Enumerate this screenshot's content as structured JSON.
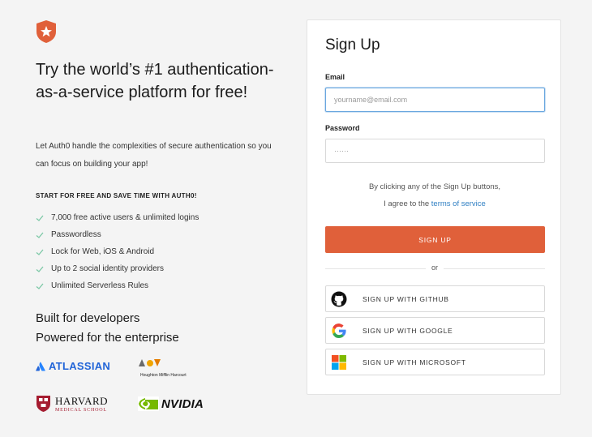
{
  "left": {
    "headline": "Try the world’s #1 authentication-as-a-service platform for free!",
    "intro": "Let Auth0 handle the complexities of secure authentication so you can focus on building your app!",
    "start_label": "START FOR FREE AND SAVE TIME WITH AUTH0!",
    "features": [
      "7,000 free active users & unlimited logins",
      "Passwordless",
      "Lock for Web, iOS & Android",
      "Up to 2 social identity providers",
      "Unlimited Serverless Rules"
    ],
    "built_line1": "Built for developers",
    "built_line2": "Powered for the enterprise",
    "logos": {
      "atlassian": "ATLASSIAN",
      "hmh": "Houghton Mifflin Harcourt",
      "harvard_main": "HARVARD",
      "harvard_sub": "MEDICAL SCHOOL",
      "nvidia": "NVIDIA"
    }
  },
  "card": {
    "title": "Sign Up",
    "email_label": "Email",
    "email_placeholder": "yourname@email.com",
    "email_value": "",
    "password_label": "Password",
    "password_placeholder": "······",
    "terms_line1": "By clicking any of the Sign Up buttons,",
    "terms_prefix": "I agree to the ",
    "terms_link": "terms of service",
    "signup_label": "SIGN UP",
    "or_label": "or",
    "social": [
      {
        "label": "SIGN UP WITH GITHUB",
        "icon": "github-icon"
      },
      {
        "label": "SIGN UP WITH GOOGLE",
        "icon": "google-icon"
      },
      {
        "label": "SIGN UP WITH MICROSOFT",
        "icon": "microsoft-icon"
      }
    ]
  },
  "colors": {
    "accent": "#e0603a",
    "link": "#2f7fc3",
    "focus_border": "#6aa7df",
    "check": "#7cc8a6"
  }
}
